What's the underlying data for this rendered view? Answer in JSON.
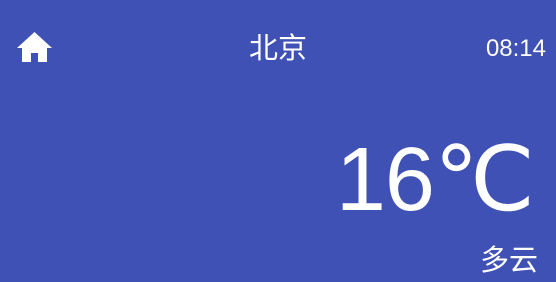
{
  "header": {
    "home_icon": "home-icon",
    "city": "北京",
    "time": "08:14"
  },
  "weather": {
    "temperature": "16℃",
    "condition": "多云"
  },
  "colors": {
    "background": "#3f51b5",
    "foreground": "#ffffff"
  }
}
